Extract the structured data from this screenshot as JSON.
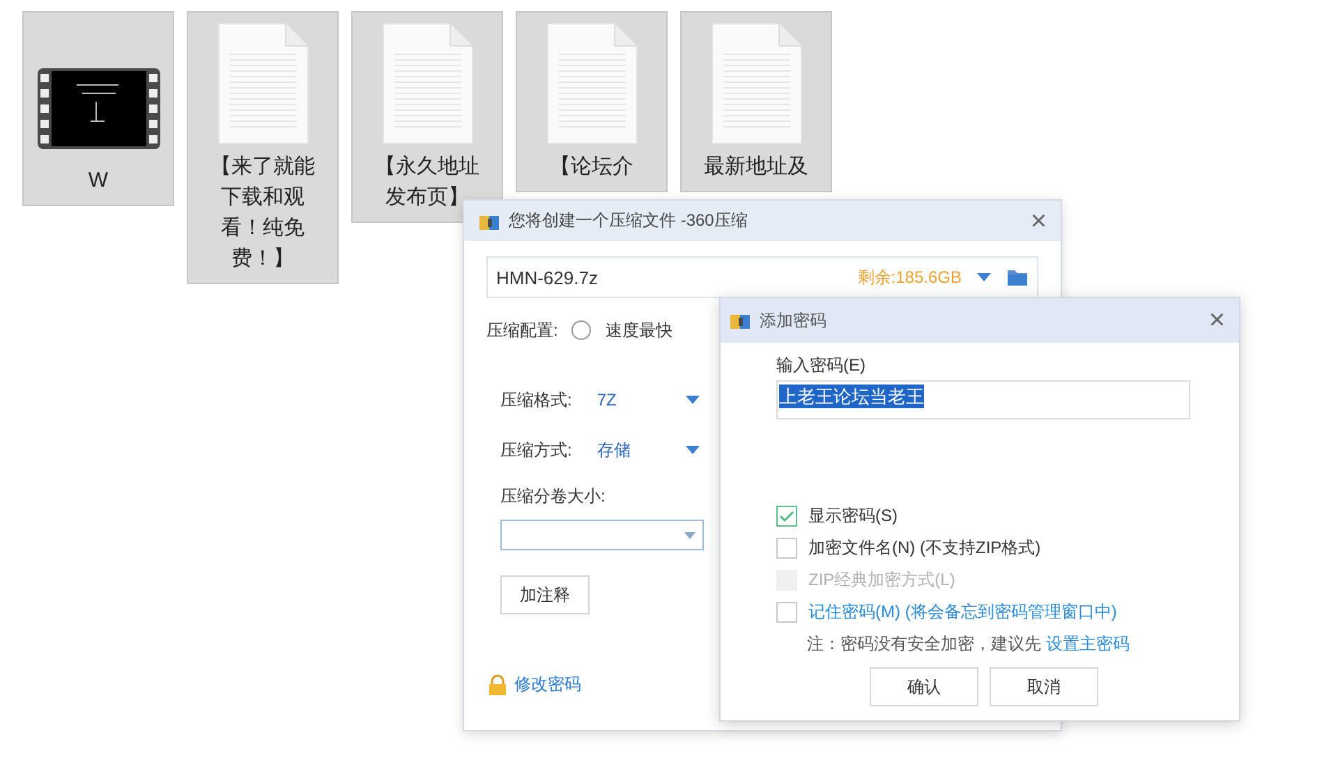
{
  "desktop_items": [
    {
      "kind": "video",
      "label": "W"
    },
    {
      "kind": "document",
      "label": "【来了就能下载和观看！纯免费！】"
    },
    {
      "kind": "document",
      "label": "【永久地址发布页】"
    },
    {
      "kind": "document",
      "label": "【论坛介"
    },
    {
      "kind": "document",
      "label": "最新地址及"
    }
  ],
  "compress_dialog": {
    "title": "您将创建一个压缩文件 -360压缩",
    "close": "×",
    "file_name": "HMN-629.7z",
    "free_space": "剩余:185.6GB",
    "config_label": "压缩配置:",
    "config_options": [
      {
        "label": "速度最快",
        "selected": false
      }
    ],
    "settings": [
      {
        "label": "压缩格式:",
        "value": "7Z"
      },
      {
        "label": "压缩方式:",
        "value": "存储"
      }
    ],
    "volume_label": "压缩分卷大小:",
    "comment_button": "加注释",
    "change_password_link": "修改密码"
  },
  "password_dialog": {
    "title": "添加密码",
    "close": "×",
    "input_label": "输入密码(E)",
    "password": {
      "value": "上老王论坛当老王",
      "selected": true
    },
    "options": [
      {
        "kind": "option",
        "label": "显示密码(S)",
        "checked": true,
        "disabled": false
      },
      {
        "kind": "option",
        "label": "加密文件名(N) (不支持ZIP格式)",
        "checked": false,
        "disabled": false
      },
      {
        "kind": "option",
        "label": "ZIP经典加密方式(L)",
        "checked": false,
        "disabled": true
      },
      {
        "kind": "link",
        "label": "记住密码(M) (将会备忘到密码管理窗口中)",
        "checked": false,
        "disabled": false
      }
    ],
    "note": "注：密码没有安全加密，建议先",
    "note_link": "设置主密码",
    "buttons": [
      "确认",
      "取消"
    ]
  }
}
